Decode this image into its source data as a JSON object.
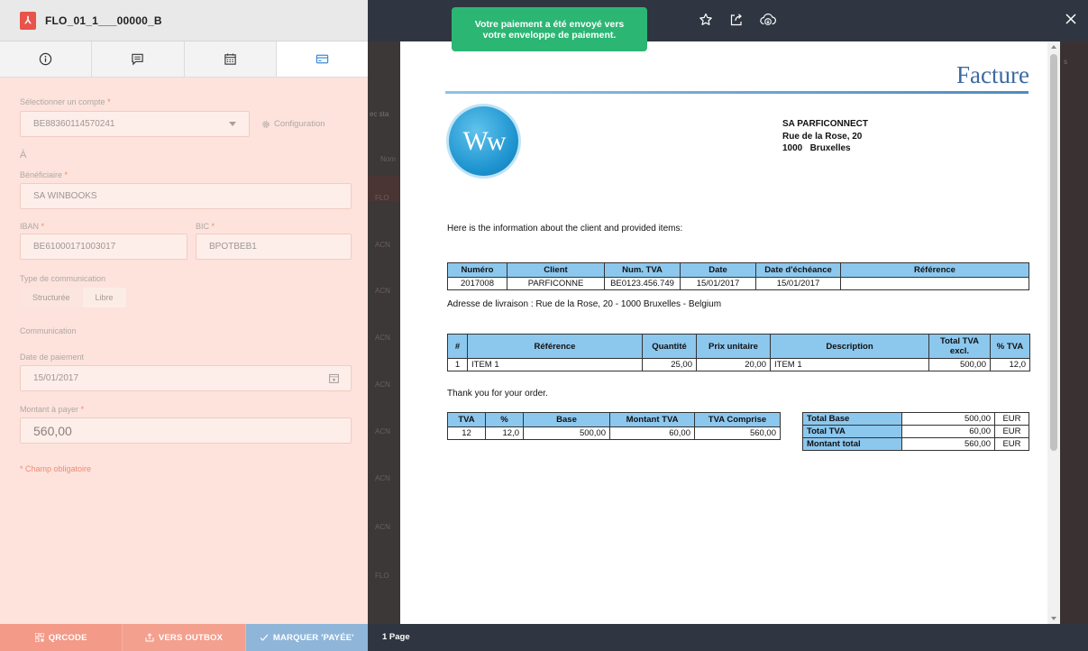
{
  "file": {
    "name": "FLO_01_1___00000_B",
    "icon": "pdf-icon"
  },
  "tabs": [
    {
      "icon": "info-icon"
    },
    {
      "icon": "comment-icon"
    },
    {
      "icon": "calendar-icon"
    },
    {
      "icon": "card-icon",
      "active": true
    }
  ],
  "form": {
    "account_label": "Sélectionner un compte",
    "account_value": "BE88360114570241",
    "configuration": "Configuration",
    "to_heading": "À",
    "beneficiary_label": "Bénéficiaire",
    "beneficiary_value": "SA WINBOOKS",
    "iban_label": "IBAN",
    "iban_value": "BE61000171003017",
    "bic_label": "BIC",
    "bic_value": "BPOTBEB1",
    "comm_type_label": "Type de communication",
    "comm_type_options": [
      "Structurée",
      "Libre"
    ],
    "communication_label": "Communication",
    "date_label": "Date de paiement",
    "date_value": "15/01/2017",
    "amount_label": "Montant à payer",
    "amount_value": "560,00",
    "required_note": "* Champ obligatoire",
    "req": "*"
  },
  "footer": {
    "qrcode": "QRCODE",
    "outbox": "VERS OUTBOX",
    "paid": "MARQUER 'PAYÉE'"
  },
  "toast": "Votre paiement a été envoyé vers votre enveloppe de paiement.",
  "viewer": {
    "pages": "1 Page",
    "icons": [
      "star-icon",
      "share-icon",
      "cloud-download-icon",
      "close-icon"
    ],
    "backdrop_rows": [
      "FLO",
      "ACN",
      "ACN",
      "ACN",
      "ACN",
      "ACN",
      "ACN",
      "ACN",
      "FLO"
    ],
    "backdrop_texts": {
      "a": "ec sta",
      "b": "Nom",
      "c": "s"
    }
  },
  "invoice": {
    "title": "Facture",
    "logo_text": "Ww",
    "company": [
      "SA PARFICONNECT",
      "Rue de la Rose, 20",
      "1000   Bruxelles"
    ],
    "intro": "Here is the information about the client and provided items:",
    "header_table": {
      "columns": [
        "Numéro",
        "Client",
        "Num. TVA",
        "Date",
        "Date d'échéance",
        "Référence"
      ],
      "row": [
        "2017008",
        "PARFICONNE",
        "BE0123.456.749",
        "15/01/2017",
        "15/01/2017",
        ""
      ]
    },
    "delivery": "Adresse de livraison : Rue de la Rose, 20 - 1000 Bruxelles - Belgium",
    "items_table": {
      "columns": [
        "#",
        "Référence",
        "Quantité",
        "Prix unitaire",
        "Description",
        "Total TVA excl.",
        "% TVA"
      ],
      "rows": [
        [
          "1",
          "ITEM 1",
          "25,00",
          "20,00",
          "ITEM 1",
          "500,00",
          "12,0"
        ]
      ]
    },
    "thanks": "Thank you for your order.",
    "vat_table": {
      "columns": [
        "TVA",
        "%",
        "Base",
        "Montant TVA",
        "TVA Comprise"
      ],
      "rows": [
        [
          "12",
          "12,0",
          "500,00",
          "60,00",
          "560,00"
        ]
      ]
    },
    "totals": [
      {
        "label": "Total Base",
        "value": "500,00",
        "cur": "EUR"
      },
      {
        "label": "Total TVA",
        "value": "60,00",
        "cur": "EUR"
      },
      {
        "label": "Montant total",
        "value": "560,00",
        "cur": "EUR"
      }
    ]
  },
  "colors": {
    "accent_salmon": "#f49a88",
    "paid_blue": "#8fb6d9",
    "toast_green": "#2bb673",
    "table_blue": "#8cc7ee"
  }
}
